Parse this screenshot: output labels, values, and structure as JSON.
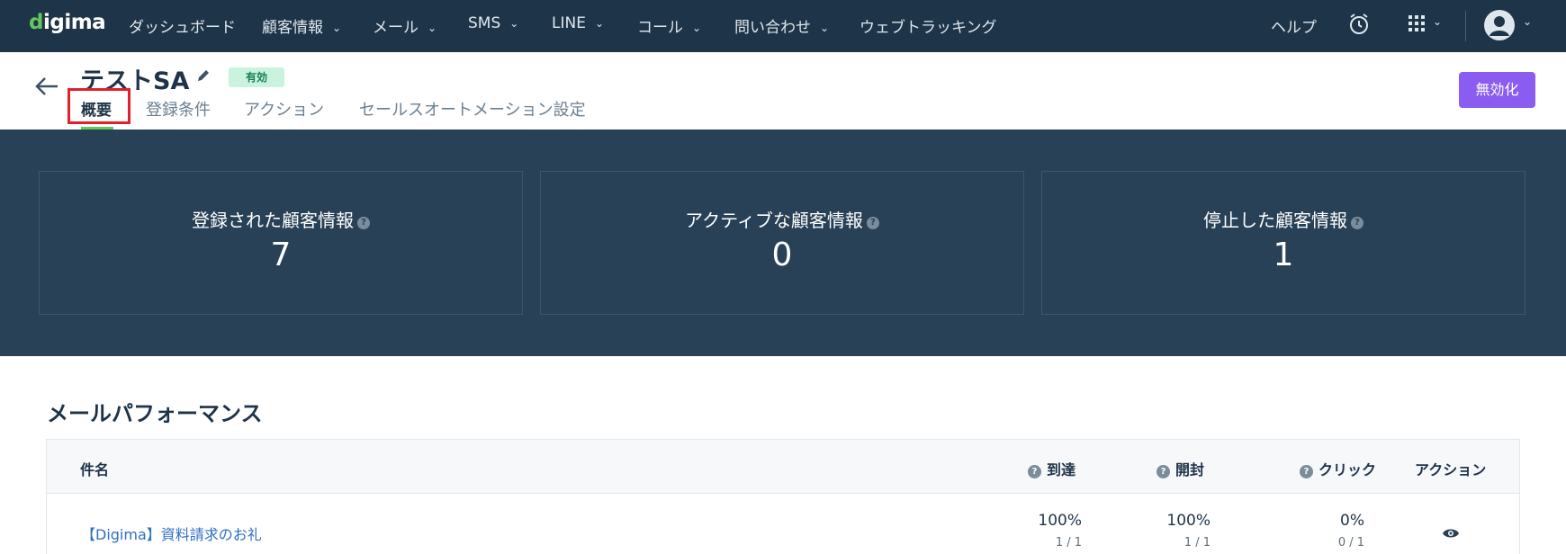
{
  "nav": {
    "logo": "digima",
    "items": [
      {
        "label": "ダッシュボード",
        "has_dropdown": false
      },
      {
        "label": "顧客情報",
        "has_dropdown": true
      },
      {
        "label": "メール",
        "has_dropdown": true
      },
      {
        "label": "SMS",
        "has_dropdown": true
      },
      {
        "label": "LINE",
        "has_dropdown": true
      },
      {
        "label": "コール",
        "has_dropdown": true
      },
      {
        "label": "問い合わせ",
        "has_dropdown": true
      },
      {
        "label": "ウェブトラッキング",
        "has_dropdown": false
      }
    ],
    "help": "ヘルプ",
    "icons": [
      "alarm-clock-icon",
      "apps-grid-icon",
      "user-avatar-icon"
    ]
  },
  "header": {
    "title": "テストSA",
    "status_badge": "有効",
    "tabs": [
      "概要",
      "登録条件",
      "アクション",
      "セールスオートメーション設定"
    ],
    "active_tab": "概要",
    "disable_button": "無効化"
  },
  "stats": [
    {
      "label": "登録された顧客情報",
      "value": "7"
    },
    {
      "label": "アクティブな顧客情報",
      "value": "0"
    },
    {
      "label": "停止した顧客情報",
      "value": "1"
    }
  ],
  "mail_performance": {
    "title": "メールパフォーマンス",
    "columns": [
      "件名",
      "到達",
      "開封",
      "クリック",
      "アクション"
    ],
    "rows": [
      {
        "subject": "【Digima】資料請求のお礼",
        "delivered_pct": "100%",
        "delivered_ratio": "1 / 1",
        "opened_pct": "100%",
        "opened_ratio": "1 / 1",
        "clicked_pct": "0%",
        "clicked_ratio": "0 / 1"
      }
    ]
  },
  "colors": {
    "nav_bg": "#1e3448",
    "stats_bg": "#294157",
    "accent_green": "#62c75c",
    "button_purple": "#8a5cf0",
    "link_blue": "#2f6fc4",
    "highlight_red": "#e0202a"
  }
}
